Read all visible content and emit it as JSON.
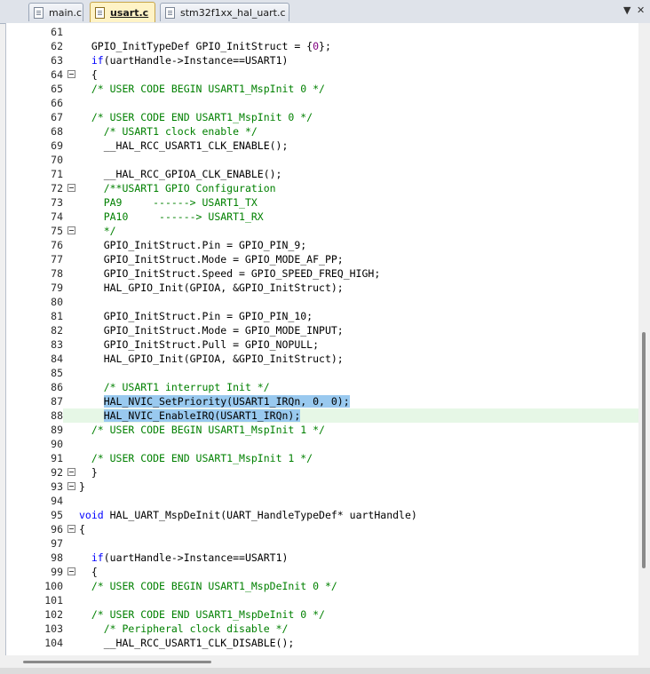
{
  "tabs": [
    {
      "label": "main.c",
      "active": false
    },
    {
      "label": "usart.c",
      "active": true
    },
    {
      "label": "stm32f1xx_hal_uart.c",
      "active": false
    }
  ],
  "tab_controls": {
    "dropdown": "▼",
    "close": "✕"
  },
  "editor": {
    "lines": [
      {
        "n": "61",
        "code": ""
      },
      {
        "n": "62",
        "code": "  GPIO_InitTypeDef GPIO_InitStruct = {0};"
      },
      {
        "n": "63",
        "code": "  if(uartHandle->Instance==USART1)"
      },
      {
        "n": "64",
        "code": "  {"
      },
      {
        "n": "65",
        "code": "  /* USER CODE BEGIN USART1_MspInit 0 */"
      },
      {
        "n": "66",
        "code": ""
      },
      {
        "n": "67",
        "code": "  /* USER CODE END USART1_MspInit 0 */"
      },
      {
        "n": "68",
        "code": "    /* USART1 clock enable */"
      },
      {
        "n": "69",
        "code": "    __HAL_RCC_USART1_CLK_ENABLE();"
      },
      {
        "n": "70",
        "code": ""
      },
      {
        "n": "71",
        "code": "    __HAL_RCC_GPIOA_CLK_ENABLE();"
      },
      {
        "n": "72",
        "code": "    /**USART1 GPIO Configuration"
      },
      {
        "n": "73",
        "code": "    PA9     ------> USART1_TX"
      },
      {
        "n": "74",
        "code": "    PA10     ------> USART1_RX"
      },
      {
        "n": "75",
        "code": "    */"
      },
      {
        "n": "76",
        "code": "    GPIO_InitStruct.Pin = GPIO_PIN_9;"
      },
      {
        "n": "77",
        "code": "    GPIO_InitStruct.Mode = GPIO_MODE_AF_PP;"
      },
      {
        "n": "78",
        "code": "    GPIO_InitStruct.Speed = GPIO_SPEED_FREQ_HIGH;"
      },
      {
        "n": "79",
        "code": "    HAL_GPIO_Init(GPIOA, &GPIO_InitStruct);"
      },
      {
        "n": "80",
        "code": ""
      },
      {
        "n": "81",
        "code": "    GPIO_InitStruct.Pin = GPIO_PIN_10;"
      },
      {
        "n": "82",
        "code": "    GPIO_InitStruct.Mode = GPIO_MODE_INPUT;"
      },
      {
        "n": "83",
        "code": "    GPIO_InitStruct.Pull = GPIO_NOPULL;"
      },
      {
        "n": "84",
        "code": "    HAL_GPIO_Init(GPIOA, &GPIO_InitStruct);"
      },
      {
        "n": "85",
        "code": ""
      },
      {
        "n": "86",
        "code": "    /* USART1 interrupt Init */"
      },
      {
        "n": "87",
        "code": "    HAL_NVIC_SetPriority(USART1_IRQn, 0, 0);"
      },
      {
        "n": "88",
        "code": "    HAL_NVIC_EnableIRQ(USART1_IRQn);"
      },
      {
        "n": "89",
        "code": "  /* USER CODE BEGIN USART1_MspInit 1 */"
      },
      {
        "n": "90",
        "code": ""
      },
      {
        "n": "91",
        "code": "  /* USER CODE END USART1_MspInit 1 */"
      },
      {
        "n": "92",
        "code": "  }"
      },
      {
        "n": "93",
        "code": "}"
      },
      {
        "n": "94",
        "code": ""
      },
      {
        "n": "95",
        "code": "void HAL_UART_MspDeInit(UART_HandleTypeDef* uartHandle)"
      },
      {
        "n": "96",
        "code": "{"
      },
      {
        "n": "97",
        "code": ""
      },
      {
        "n": "98",
        "code": "  if(uartHandle->Instance==USART1)"
      },
      {
        "n": "99",
        "code": "  {"
      },
      {
        "n": "100",
        "code": "  /* USER CODE BEGIN USART1_MspDeInit 0 */"
      },
      {
        "n": "101",
        "code": ""
      },
      {
        "n": "102",
        "code": "  /* USER CODE END USART1_MspDeInit 0 */"
      },
      {
        "n": "103",
        "code": "    /* Peripheral clock disable */"
      },
      {
        "n": "104",
        "code": "    __HAL_RCC_USART1_CLK_DISABLE();"
      }
    ],
    "fold_markers": [
      "64",
      "72",
      "75",
      "92",
      "93",
      "96",
      "99"
    ],
    "selected_lines": [
      "87",
      "88"
    ],
    "current_line": "88"
  }
}
